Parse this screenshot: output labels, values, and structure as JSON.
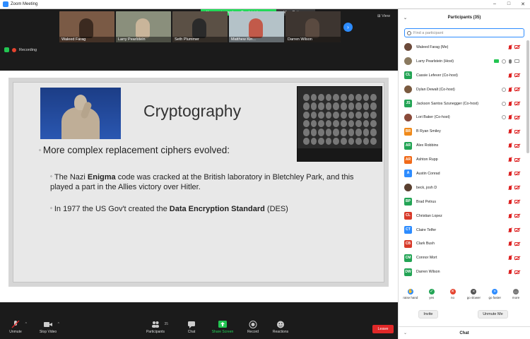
{
  "window": {
    "title": "Zoom Meeting",
    "controls": [
      "–",
      "□",
      "✕"
    ]
  },
  "share_banner": {
    "message": "You are viewing Larry Pearlstein's screen",
    "options_label": "View Options ⌄"
  },
  "gallery": {
    "tiles": [
      {
        "name": "Waleed Farag",
        "bg": "#7a5a45",
        "person": "#3b2a20"
      },
      {
        "name": "Larry Pearlstein",
        "bg": "#8a8f7c",
        "person": "#c9b59a"
      },
      {
        "name": "Seth Plummer",
        "bg": "#5b5045",
        "person": "#2a2a2a"
      },
      {
        "name": "Matthew Kin...",
        "bg": "#b4c2c8",
        "person": "#c25a4a"
      },
      {
        "name": "Darren Wilson",
        "bg": "#3d3530",
        "person": "#5a4a40"
      }
    ],
    "view_label": "⊞ View"
  },
  "status": {
    "recording_label": "Recording"
  },
  "slide": {
    "title": "Cryptography",
    "bullet1": "More complex replacement ciphers evolved:",
    "bullet2_pre": "The Nazi ",
    "bullet2_bold": "Enigma",
    "bullet2_post": " code was cracked at the British laboratory in Bletchley Park, and this played a part in the Allies victory over Hitler.",
    "bullet3_pre": "In 1977 the US Gov't created the ",
    "bullet3_bold": "Data Encryption Standard",
    "bullet3_post": " (DES)",
    "bullet_marker": "◦"
  },
  "toolbar": {
    "unmute": "Unmute",
    "stop_video": "Stop Video",
    "participants": "Participants",
    "participants_count": "35",
    "chat": "Chat",
    "share_screen": "Share Screen",
    "record": "Record",
    "reactions": "Reactions",
    "leave": "Leave"
  },
  "panel": {
    "title": "Participants (35)",
    "search_placeholder": "Find a participant",
    "participants": [
      {
        "name": "Waleed Farag (Me)",
        "initials": "",
        "color": "#6b4a3a",
        "photo": true,
        "icons": [
          "mic-muted",
          "cam-muted"
        ]
      },
      {
        "name": "Larry Pearlstein (Host)",
        "initials": "",
        "color": "#8a7a60",
        "photo": true,
        "icons": [
          "screen",
          "rec",
          "mic",
          "cam"
        ]
      },
      {
        "name": "Cassie Lefever (Co-host)",
        "initials": "CL",
        "color": "#23a455",
        "photo": false,
        "icons": [
          "mic-muted",
          "cam-muted"
        ]
      },
      {
        "name": "Dylan Dewalt (Co-host)",
        "initials": "",
        "color": "#7a5a40",
        "photo": true,
        "icons": [
          "rec",
          "mic-muted",
          "cam-muted"
        ]
      },
      {
        "name": "Jackson Santos Szunegger (Co-host)",
        "initials": "JS",
        "color": "#23a455",
        "photo": false,
        "icons": [
          "rec",
          "mic-muted",
          "cam-muted"
        ]
      },
      {
        "name": "Lori Baker (Co-host)",
        "initials": "",
        "color": "#8a4a3a",
        "photo": true,
        "icons": [
          "rec",
          "mic-muted",
          "cam-muted"
        ]
      },
      {
        "name": "B Ryan Smiley",
        "initials": "BR",
        "color": "#f08a1a",
        "photo": false,
        "icons": [
          "mic-muted",
          "cam-muted"
        ]
      },
      {
        "name": "Alex Robbins",
        "initials": "AR",
        "color": "#23a455",
        "photo": false,
        "icons": [
          "mic-muted",
          "cam-muted"
        ]
      },
      {
        "name": "Ashton Rupp",
        "initials": "AR",
        "color": "#f06a1a",
        "photo": false,
        "icons": [
          "mic-muted",
          "cam-muted"
        ]
      },
      {
        "name": "Austin Conrad",
        "initials": "A",
        "color": "#2d8cff",
        "photo": false,
        "icons": [
          "mic-muted",
          "cam-muted"
        ]
      },
      {
        "name": "beck, josh D",
        "initials": "",
        "color": "#5a4030",
        "photo": true,
        "icons": [
          "mic-muted",
          "cam-muted"
        ]
      },
      {
        "name": "Brad Petrus",
        "initials": "BP",
        "color": "#23a455",
        "photo": false,
        "icons": [
          "mic-muted",
          "cam-muted"
        ]
      },
      {
        "name": "Christian Lopez",
        "initials": "CL",
        "color": "#d83a2a",
        "photo": false,
        "icons": [
          "mic-muted",
          "cam-muted"
        ]
      },
      {
        "name": "Claire Telfer",
        "initials": "CT",
        "color": "#2d8cff",
        "photo": false,
        "icons": [
          "mic-muted",
          "cam-muted"
        ]
      },
      {
        "name": "Clark Bush",
        "initials": "CB",
        "color": "#d83a2a",
        "photo": false,
        "icons": [
          "mic-muted",
          "cam-muted"
        ]
      },
      {
        "name": "Connor Mort",
        "initials": "CM",
        "color": "#23a455",
        "photo": false,
        "icons": [
          "mic-muted",
          "cam-muted"
        ]
      },
      {
        "name": "Darren Wilson",
        "initials": "DW",
        "color": "#23a455",
        "photo": false,
        "icons": [
          "mic-muted",
          "cam-muted"
        ]
      }
    ],
    "reactions": [
      {
        "label": "raise hand",
        "color": "#2d8cff",
        "glyph": "✋"
      },
      {
        "label": "yes",
        "color": "#23a455",
        "glyph": "✓"
      },
      {
        "label": "no",
        "color": "#e5432e",
        "glyph": "✕"
      },
      {
        "label": "go slower",
        "color": "#555",
        "glyph": "«"
      },
      {
        "label": "go faster",
        "color": "#2d8cff",
        "glyph": "»"
      },
      {
        "label": "more",
        "color": "#777",
        "glyph": "…"
      }
    ],
    "invite_label": "Invite",
    "unmute_me_label": "Unmute Me",
    "chat_label": "Chat"
  }
}
